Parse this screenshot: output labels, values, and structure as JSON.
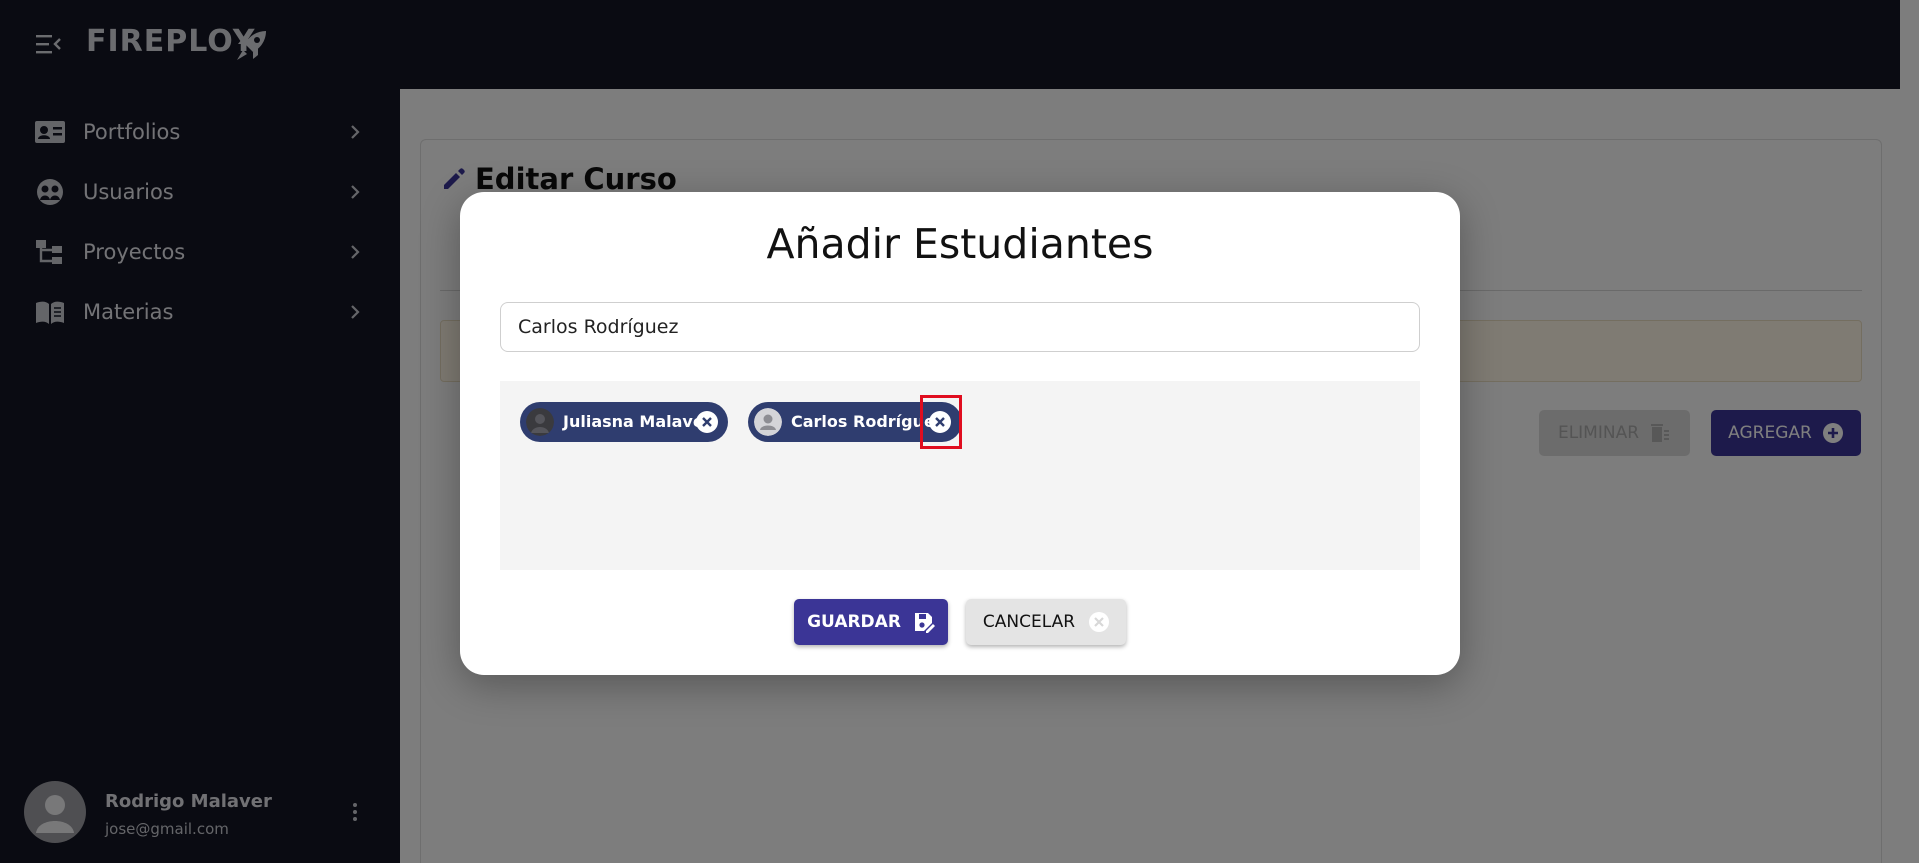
{
  "app": {
    "brand": "FIREPLOY",
    "accent_color": "#3b3596",
    "sidebar_bg": "#151725"
  },
  "sidebar": {
    "items": [
      {
        "label": "Portfolios",
        "icon": "id-card-icon"
      },
      {
        "label": "Usuarios",
        "icon": "users-icon"
      },
      {
        "label": "Proyectos",
        "icon": "hierarchy-icon"
      },
      {
        "label": "Materias",
        "icon": "book-icon"
      }
    ],
    "user": {
      "name": "Rodrigo Malaver",
      "email": "jose@gmail.com"
    }
  },
  "page": {
    "title": "Editar Curso",
    "eliminar_label": "ELIMINAR",
    "agregar_label": "AGREGAR"
  },
  "modal": {
    "title": "Añadir Estudiantes",
    "search_value": "Carlos Rodríguez",
    "chips": [
      {
        "label": "Juliasna Malaver"
      },
      {
        "label": "Carlos Rodríguez"
      }
    ],
    "guardar_label": "GUARDAR",
    "cancelar_label": "CANCELAR"
  }
}
